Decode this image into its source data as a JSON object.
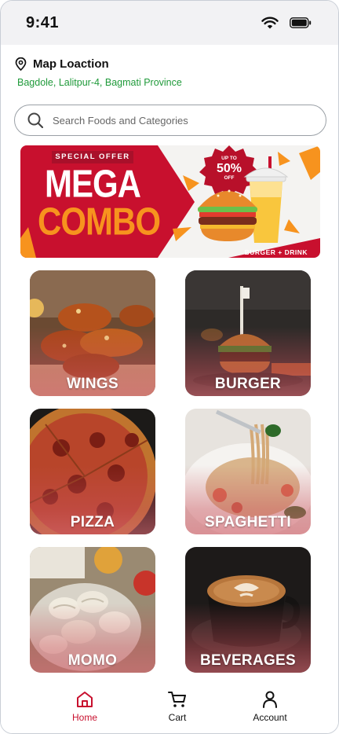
{
  "status_bar": {
    "time": "9:41"
  },
  "location": {
    "title": "Map Loaction",
    "address": "Bagdole, Lalitpur-4, Bagmati Province"
  },
  "search": {
    "placeholder": "Search Foods and Categories",
    "value": ""
  },
  "banner": {
    "tag": "SPECIAL OFFER",
    "title_line1": "MEGA",
    "title_line2": "COMBO",
    "badge_top": "UP TO",
    "badge_value": "50%",
    "badge_bottom": "OFF",
    "caption": "BURGER + DRINK"
  },
  "categories": [
    {
      "label": "WINGS"
    },
    {
      "label": "BURGER"
    },
    {
      "label": "PIZZA"
    },
    {
      "label": "SPAGHETTI"
    },
    {
      "label": "MOMO"
    },
    {
      "label": "BEVERAGES"
    }
  ],
  "bottom_nav": {
    "items": [
      {
        "label": "Home",
        "icon": "home-icon",
        "active": true
      },
      {
        "label": "Cart",
        "icon": "cart-icon",
        "active": false
      },
      {
        "label": "Account",
        "icon": "user-icon",
        "active": false
      }
    ]
  },
  "colors": {
    "accent": "#c8102e",
    "location_green": "#1f9a3a",
    "banner_red": "#c8102e",
    "banner_orange": "#f7931e"
  }
}
